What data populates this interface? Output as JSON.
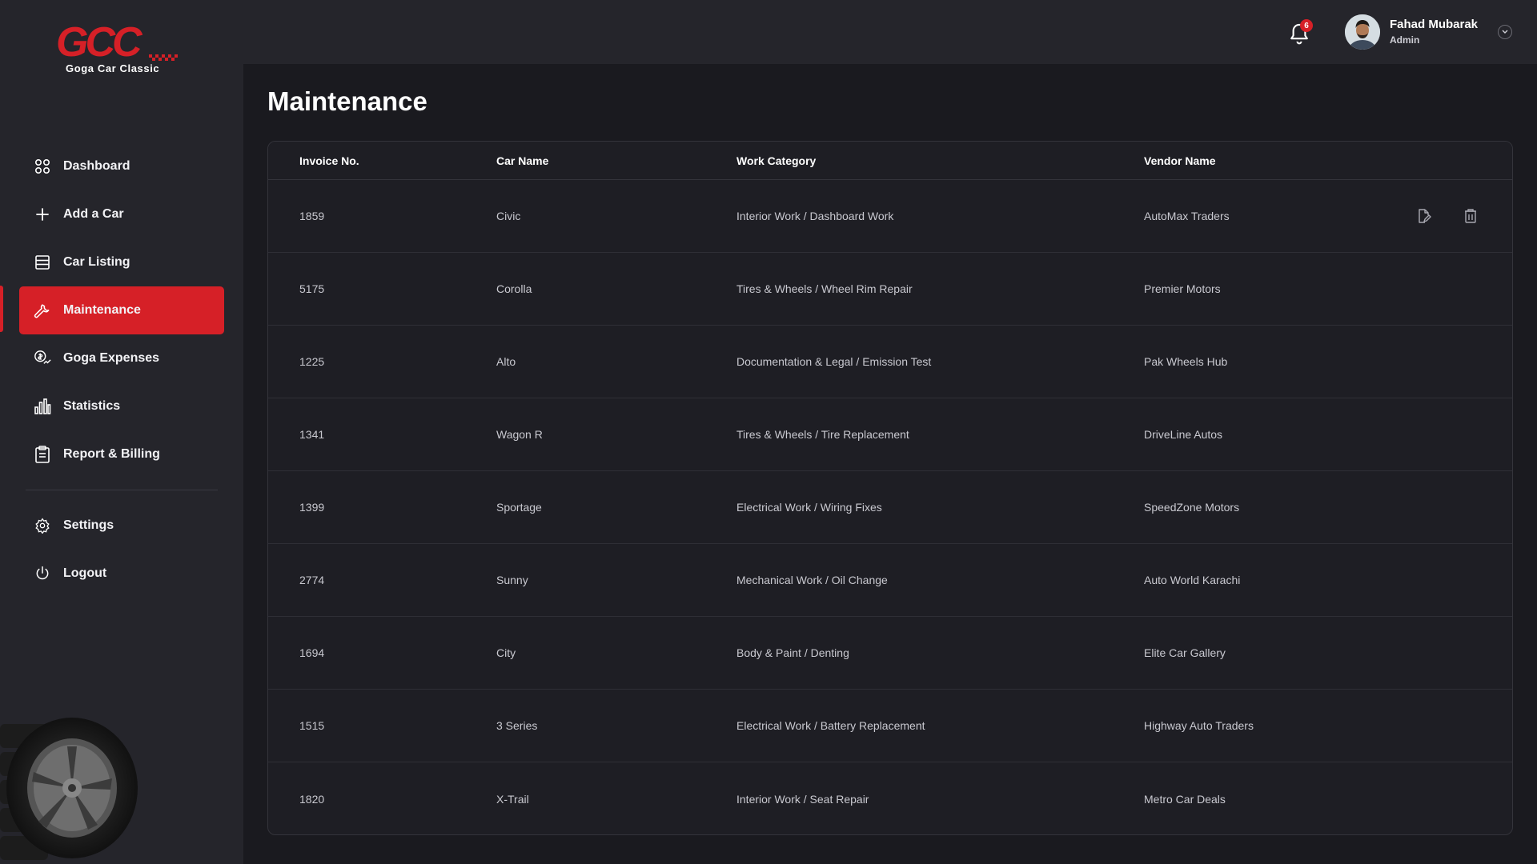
{
  "brand": {
    "logo_text": "GCC",
    "logo_subtitle": "Goga Car Classic"
  },
  "sidebar": {
    "items": [
      {
        "label": "Dashboard",
        "icon": "grid-icon"
      },
      {
        "label": "Add a Car",
        "icon": "plus-icon"
      },
      {
        "label": "Car Listing",
        "icon": "list-icon"
      },
      {
        "label": "Maintenance",
        "icon": "wrench-icon",
        "active": true
      },
      {
        "label": "Goga Expenses",
        "icon": "expenses-icon"
      },
      {
        "label": "Statistics",
        "icon": "bar-chart-icon"
      },
      {
        "label": "Report & Billing",
        "icon": "clipboard-icon"
      }
    ],
    "bottom_items": [
      {
        "label": "Settings",
        "icon": "gear-icon"
      },
      {
        "label": "Logout",
        "icon": "power-icon"
      }
    ]
  },
  "header": {
    "notification_count": "6",
    "user_name": "Fahad Mubarak",
    "user_role": "Admin"
  },
  "page": {
    "title": "Maintenance"
  },
  "table": {
    "columns": [
      "Invoice No.",
      "Car Name",
      "Work Category",
      "Vendor Name"
    ],
    "rows": [
      [
        "1859",
        "Civic",
        "Interior Work / Dashboard Work",
        "AutoMax Traders"
      ],
      [
        "5175",
        "Corolla",
        "Tires & Wheels / Wheel Rim Repair",
        "Premier Motors"
      ],
      [
        "1225",
        "Alto",
        "Documentation & Legal / Emission Test",
        "Pak Wheels Hub"
      ],
      [
        "1341",
        "Wagon R",
        "Tires & Wheels / Tire Replacement",
        "DriveLine Autos"
      ],
      [
        "1399",
        "Sportage",
        "Electrical Work / Wiring Fixes",
        "SpeedZone Motors"
      ],
      [
        "2774",
        "Sunny",
        "Mechanical Work / Oil Change",
        "Auto World Karachi"
      ],
      [
        "1694",
        "City",
        "Body & Paint / Denting",
        "Elite Car Gallery"
      ],
      [
        "1515",
        "3 Series",
        "Electrical Work / Battery Replacement",
        "Highway Auto Traders"
      ],
      [
        "1820",
        "X-Trail",
        "Interior Work / Seat Repair",
        "Metro Car Deals"
      ]
    ],
    "row_actions": [
      "edit-icon",
      "delete-icon"
    ]
  },
  "colors": {
    "accent": "#d62027",
    "sidebar_bg": "#25252b",
    "page_bg": "#1a1a1f"
  }
}
